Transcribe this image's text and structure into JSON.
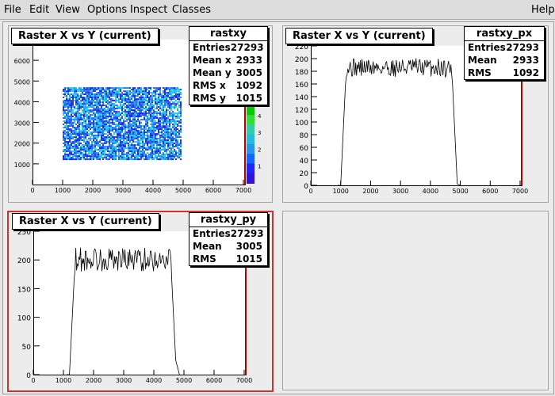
{
  "menu": {
    "file": "File",
    "edit": "Edit",
    "view": "View",
    "options": "Options",
    "inspect": "Inspect",
    "classes": "Classes",
    "help": "Help"
  },
  "pads": {
    "tl": {
      "title": "Raster X vs Y (current)",
      "stats": {
        "name": "rastxy",
        "rows": [
          {
            "label": "Entries",
            "value": "27293"
          },
          {
            "label": "Mean x",
            "value": "2933"
          },
          {
            "label": "Mean y",
            "value": "3005"
          },
          {
            "label": "RMS x",
            "value": "1092"
          },
          {
            "label": "RMS y",
            "value": "1015"
          }
        ]
      }
    },
    "tr": {
      "title": "Raster X vs Y (current)",
      "stats": {
        "name": "rastxy_px",
        "rows": [
          {
            "label": "Entries",
            "value": "27293"
          },
          {
            "label": "Mean",
            "value": "2933"
          },
          {
            "label": "RMS",
            "value": "1092"
          }
        ]
      }
    },
    "bl": {
      "title": "Raster X vs Y (current)",
      "stats": {
        "name": "rastxy_py",
        "rows": [
          {
            "label": "Entries",
            "value": "27293"
          },
          {
            "label": "Mean",
            "value": "3005"
          },
          {
            "label": "RMS",
            "value": "1015"
          }
        ]
      }
    }
  },
  "chart_data": [
    {
      "type": "heatmap",
      "title": "Raster X vs Y (current)",
      "xlim": [
        0,
        7000
      ],
      "ylim": [
        0,
        7000
      ],
      "x_ticks": [
        "0",
        "1000",
        "2000",
        "3000",
        "4000",
        "5000",
        "6000",
        "7000"
      ],
      "y_ticks": [
        "1000",
        "2000",
        "3000",
        "4000",
        "5000",
        "6000"
      ],
      "region": {
        "x": [
          1000,
          4900
        ],
        "y": [
          1200,
          4700
        ]
      },
      "z_ticks": [
        "1",
        "2",
        "3",
        "4"
      ]
    },
    {
      "type": "line",
      "title": "Raster X vs Y (current)",
      "xlim": [
        0,
        7000
      ],
      "ylim": [
        0,
        220
      ],
      "x_ticks": [
        "0",
        "1000",
        "2000",
        "3000",
        "4000",
        "5000",
        "6000",
        "7000"
      ],
      "y_ticks": [
        "0",
        "20",
        "40",
        "60",
        "80",
        "100",
        "120",
        "140",
        "160",
        "180",
        "200",
        "220"
      ],
      "edges": [
        1000,
        4900
      ],
      "plateau": [
        150,
        210
      ]
    },
    {
      "type": "line",
      "title": "Raster X vs Y (current)",
      "xlim": [
        0,
        7000
      ],
      "ylim": [
        0,
        250
      ],
      "x_ticks": [
        "0",
        "1000",
        "2000",
        "3000",
        "4000",
        "5000",
        "6000",
        "7000"
      ],
      "y_ticks": [
        "0",
        "50",
        "100",
        "150",
        "200",
        "250"
      ],
      "edges": [
        1200,
        4750
      ],
      "plateau": [
        150,
        235
      ]
    }
  ]
}
